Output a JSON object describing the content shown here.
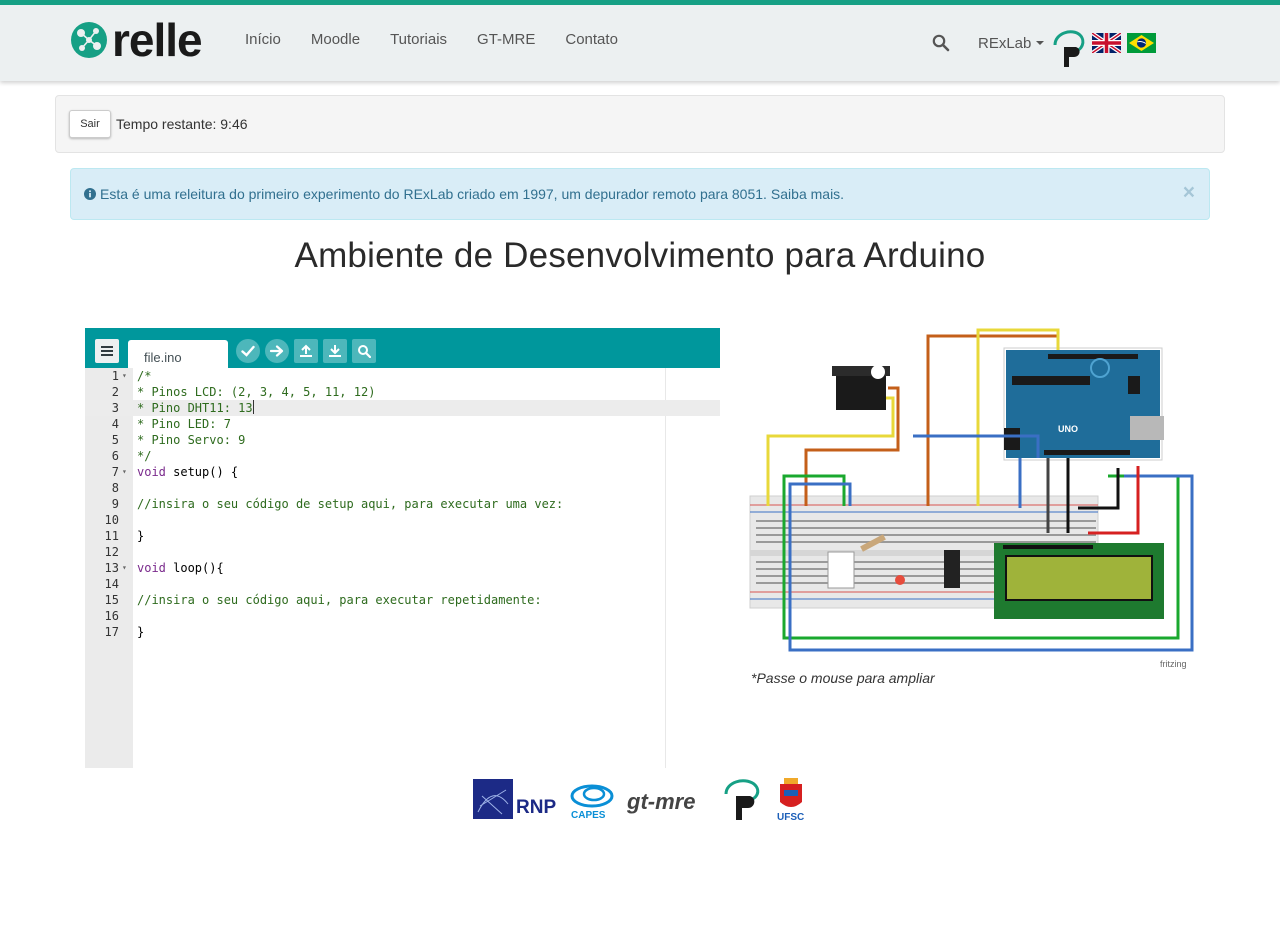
{
  "brand": {
    "name": "relle"
  },
  "nav": {
    "links": [
      {
        "label": "Início"
      },
      {
        "label": "Moodle"
      },
      {
        "label": "Tutoriais"
      },
      {
        "label": "GT-MRE"
      },
      {
        "label": "Contato"
      }
    ],
    "dropdown_label": "RExLab"
  },
  "timer": {
    "exit_label": "Sair",
    "remaining_text": "Tempo restante: 9:46"
  },
  "alert": {
    "message": "Esta é uma releitura do primeiro experimento do RExLab criado em 1997, um depurador remoto para 8051.",
    "link_text": "Saiba mais.",
    "close_glyph": "×"
  },
  "page_title": "Ambiente de Desenvolvimento para Arduino",
  "editor": {
    "file_tab": "file.ino",
    "active_line": 3,
    "lines": [
      {
        "n": "1",
        "text": "/*"
      },
      {
        "n": "2",
        "text": "* Pinos LCD: (2, 3, 4, 5, 11, 12)"
      },
      {
        "n": "3",
        "text": "* Pino DHT11: 13"
      },
      {
        "n": "4",
        "text": "* Pino LED: 7"
      },
      {
        "n": "5",
        "text": "* Pino Servo: 9"
      },
      {
        "n": "6",
        "text": "*/"
      },
      {
        "n": "7",
        "kw": "void",
        "text": " setup() {"
      },
      {
        "n": "8",
        "text": ""
      },
      {
        "n": "9",
        "text": "//insira o seu código de setup aqui, para executar uma vez:"
      },
      {
        "n": "10",
        "text": ""
      },
      {
        "n": "11",
        "text": "}"
      },
      {
        "n": "12",
        "text": ""
      },
      {
        "n": "13",
        "kw": "void",
        "text": " loop(){"
      },
      {
        "n": "14",
        "text": ""
      },
      {
        "n": "15",
        "text": "//insira o seu código aqui, para executar repetidamente:"
      },
      {
        "n": "16",
        "text": ""
      },
      {
        "n": "17",
        "text": "}"
      }
    ]
  },
  "circuit": {
    "caption": "*Passe o mouse para ampliar",
    "watermark": "fritzing",
    "board_label": "UNO"
  },
  "footer": {
    "logos": [
      "RNP",
      "CAPES",
      "gt-mre",
      "UFSC"
    ]
  },
  "colors": {
    "brand_green": "#16a085",
    "editor_teal": "#00979c",
    "alert_text": "#31708f"
  },
  "icons": [
    "search-icon",
    "menu-icon",
    "verify-icon",
    "upload-arrow-icon",
    "upload-icon",
    "download-icon",
    "serial-monitor-icon",
    "info-icon",
    "close-icon"
  ]
}
